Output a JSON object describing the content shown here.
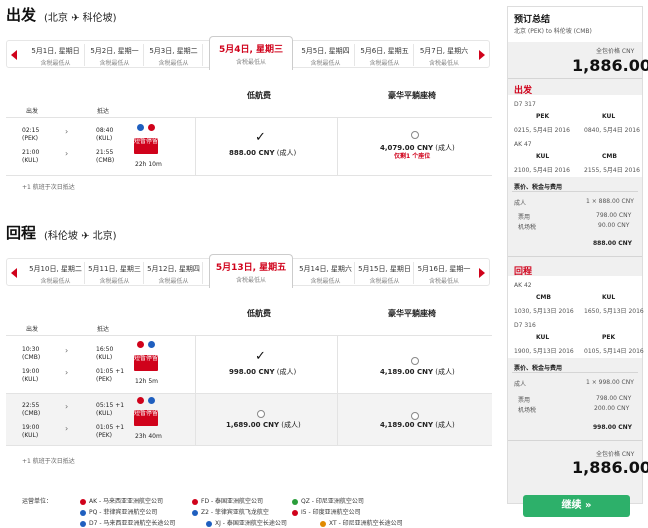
{
  "outbound": {
    "title": "出发",
    "route": "(北京 ✈ 科伦坡)",
    "dates": [
      {
        "d": "5月1日, 星期日",
        "p": "含税最低从"
      },
      {
        "d": "5月2日, 星期一",
        "p": "含税最低从"
      },
      {
        "d": "5月3日, 星期二",
        "p": "含税最低从"
      },
      {
        "d": "5月4日, 星期三",
        "p": "含税最低从"
      },
      {
        "d": "5月5日, 星期四",
        "p": "含税最低从"
      },
      {
        "d": "5月6日, 星期五",
        "p": "含税最低从"
      },
      {
        "d": "5月7日, 星期六",
        "p": "含税最低从"
      }
    ],
    "col_low": "低航费",
    "col_premium": "豪华平躺座椅",
    "col_depart": "出发",
    "col_arrive": "抵达",
    "flight": {
      "dep1": "02:15",
      "dep1c": "(PEK)",
      "dep2": "21:00",
      "dep2c": "(KUL)",
      "arr1": "08:40",
      "arr1c": "(KUL)",
      "arr2": "21:55",
      "arr2c": "(CMB)",
      "sticker": "短暂停留",
      "duration": "22h 10m",
      "low_price": "888.00 CNY",
      "low_note": "(成人)",
      "prem_price": "4,079.00 CNY",
      "prem_note": "(成人)",
      "prem_warn": "仅剩1 个座位"
    },
    "footnote": "+1 航班于次日抵达"
  },
  "inbound": {
    "title": "回程",
    "route": "(科伦坡 ✈ 北京)",
    "dates": [
      {
        "d": "5月10日, 星期二",
        "p": "含税最低从"
      },
      {
        "d": "5月11日, 星期三",
        "p": "含税最低从"
      },
      {
        "d": "5月12日, 星期四",
        "p": "含税最低从"
      },
      {
        "d": "5月13日, 星期五",
        "p": "含税最低从"
      },
      {
        "d": "5月14日, 星期六",
        "p": "含税最低从"
      },
      {
        "d": "5月15日, 星期日",
        "p": "含税最低从"
      },
      {
        "d": "5月16日, 星期一",
        "p": "含税最低从"
      }
    ],
    "col_low": "低航费",
    "col_premium": "豪华平躺座椅",
    "col_depart": "出发",
    "col_arrive": "抵达",
    "flights": [
      {
        "dep1": "10:30",
        "dep1c": "(CMB)",
        "dep2": "19:00",
        "dep2c": "(KUL)",
        "arr1": "16:50",
        "arr1c": "(KUL)",
        "arr2": "01:05 +1",
        "arr2c": "(PEK)",
        "sticker": "短暂停留",
        "duration": "12h 5m",
        "low_price": "998.00 CNY",
        "low_note": "(成人)",
        "prem_price": "4,189.00 CNY",
        "prem_note": "(成人)"
      },
      {
        "dep1": "22:55",
        "dep1c": "(CMB)",
        "dep2": "19:00",
        "dep2c": "(KUL)",
        "arr1": "05:15 +1",
        "arr1c": "(KUL)",
        "arr2": "01:05 +1",
        "arr2c": "(PEK)",
        "sticker": "短暂停留",
        "duration": "23h 40m",
        "low_price": "1,689.00 CNY",
        "low_note": "(成人)",
        "prem_price": "4,189.00 CNY",
        "prem_note": "(成人)"
      }
    ],
    "footnote": "+1 航班于次日抵达"
  },
  "legend": {
    "label": "运营单位：",
    "items": [
      {
        "t": "AK - 马来西亚亚洲航空公司",
        "c": "#d0021b"
      },
      {
        "t": "FD - 泰国亚洲航空公司",
        "c": "#d0021b"
      },
      {
        "t": "QZ - 印尼亚洲航空公司",
        "c": "#2a9d3a"
      },
      {
        "t": "PQ - 菲律宾亚洲航空公司",
        "c": "#1f5fbf"
      },
      {
        "t": "Z2 - 菲律宾亚航飞龙航空",
        "c": "#1f5fbf"
      },
      {
        "t": "I5 - 印度亚洲航空公司",
        "c": "#d0021b"
      },
      {
        "t": "D7 - 马来西亚亚洲航空长途公司",
        "c": "#1f5fbf"
      },
      {
        "t": "XJ - 泰国亚洲航空长途公司",
        "c": "#1f5fbf"
      },
      {
        "t": "XT - 印尼亚洲航空长途公司",
        "c": "#e08a00"
      }
    ]
  },
  "summary": {
    "title": "预订总结",
    "route": "北京 (PEK) to 科伦坡 (CMB)",
    "total_label": "全包价格 CNY",
    "total": "1,886.00",
    "out_label": "出发",
    "out_seg1_flight": "D7 317",
    "out_seg1_from": "PEK",
    "out_seg1_to": "KUL",
    "out_seg1_dep": "0215, 5月4日 2016",
    "out_seg1_arr": "0840, 5月4日 2016",
    "out_seg2_flight": "AK 47",
    "out_seg2_from": "KUL",
    "out_seg2_to": "CMB",
    "out_seg2_dep": "2100, 5月4日 2016",
    "out_seg2_arr": "2155, 5月4日 2016",
    "fees_label": "票价、税金与费用",
    "out_adult": "成人",
    "out_adult_val": "1 × 888.00 CNY",
    "out_fare_l": "票用",
    "out_fare_v": "798.00 CNY",
    "out_tax_l": "机场税",
    "out_tax_v": "90.00 CNY",
    "out_sub": "888.00 CNY",
    "in_label": "回程",
    "in_seg1_flight": "AK 42",
    "in_seg1_from": "CMB",
    "in_seg1_to": "KUL",
    "in_seg1_dep": "1030, 5月13日 2016",
    "in_seg1_arr": "1650, 5月13日 2016",
    "in_seg2_flight": "D7 316",
    "in_seg2_from": "KUL",
    "in_seg2_to": "PEK",
    "in_seg2_dep": "1900, 5月13日 2016",
    "in_seg2_arr": "0105, 5月14日 2016",
    "in_adult": "成人",
    "in_adult_val": "1 × 998.00 CNY",
    "in_fare_l": "票用",
    "in_fare_v": "798.00 CNY",
    "in_tax_l": "机场税",
    "in_tax_v": "200.00 CNY",
    "in_sub": "998.00 CNY",
    "total_label2": "全包价格 CNY",
    "total2": "1,886.00",
    "continue": "继续 »"
  },
  "colors": {
    "brand_red": "#d0021b",
    "cta_green": "#2db06a"
  },
  "icons": [
    "airline-logo-icon",
    "chevron-right-icon",
    "checkmark-icon",
    "radio-icon",
    "arrow-left-icon",
    "arrow-right-icon",
    "plane-icon"
  ]
}
